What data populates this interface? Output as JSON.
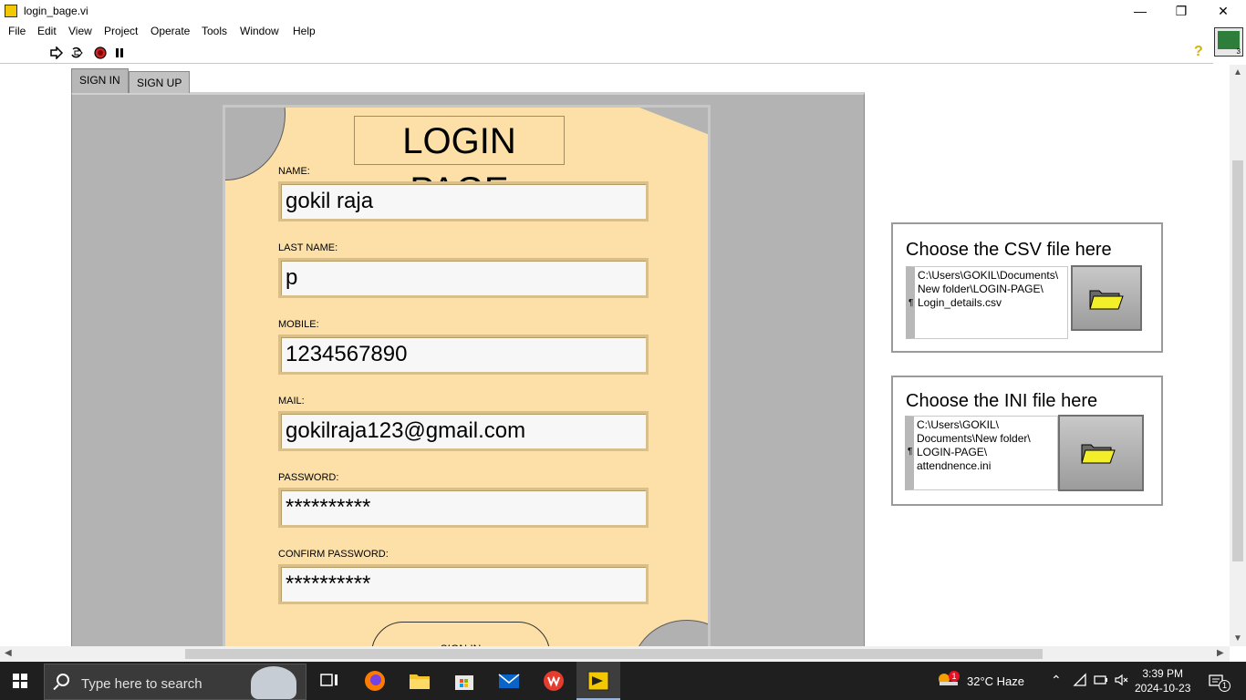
{
  "window": {
    "title": "login_bage.vi",
    "minimize_glyph": "—",
    "restore_glyph": "❐",
    "close_glyph": "✕"
  },
  "menu": [
    "File",
    "Edit",
    "View",
    "Project",
    "Operate",
    "Tools",
    "Window",
    "Help"
  ],
  "toolbar": {
    "icons": [
      "run-arrow-icon",
      "run-continuous-icon",
      "abort-icon",
      "pause-icon",
      "help-icon"
    ],
    "help_glyph": "?",
    "panel_icon_number": "3"
  },
  "tabs": [
    {
      "label": "SIGN IN",
      "active": true
    },
    {
      "label": "SIGN UP",
      "active": false
    }
  ],
  "login": {
    "title": "LOGIN PAGE",
    "fields": [
      {
        "label": "NAME:",
        "value": "gokil raja"
      },
      {
        "label": "LAST NAME:",
        "value": "p"
      },
      {
        "label": "MOBILE:",
        "value": "1234567890"
      },
      {
        "label": "MAIL:",
        "value": "gokilraja123@gmail.com"
      },
      {
        "label": "PASSWORD:",
        "value": "**********"
      },
      {
        "label": "CONFIRM PASSWORD:",
        "value": "**********"
      }
    ],
    "sign_in_label": "SIGN IN"
  },
  "csv_chooser": {
    "heading": "Choose the CSV file here",
    "path_lines": [
      "C:\\Users\\GOKIL\\Documents\\",
      "New folder\\LOGIN-PAGE\\",
      "Login_details.csv"
    ],
    "browse_icon": "folder-icon"
  },
  "ini_chooser": {
    "heading": "Choose the INI  file here",
    "path_lines": [
      "C:\\Users\\GOKIL\\",
      "Documents\\New folder\\",
      "LOGIN-PAGE\\",
      "attendnence.ini"
    ],
    "browse_icon": "folder-icon"
  },
  "taskbar": {
    "search_placeholder": "Type here to search",
    "weather_badge": "1",
    "weather": "32°C  Haze",
    "time": "3:39 PM",
    "date": "2024-10-23",
    "notification_count": "1",
    "colors": {
      "accent": "#9ab5d8",
      "background": "#1f1f1f"
    }
  },
  "colors": {
    "paper": "#fde0a7",
    "tab_page": "#b3b3b3",
    "folder": "#f2ef2a"
  }
}
